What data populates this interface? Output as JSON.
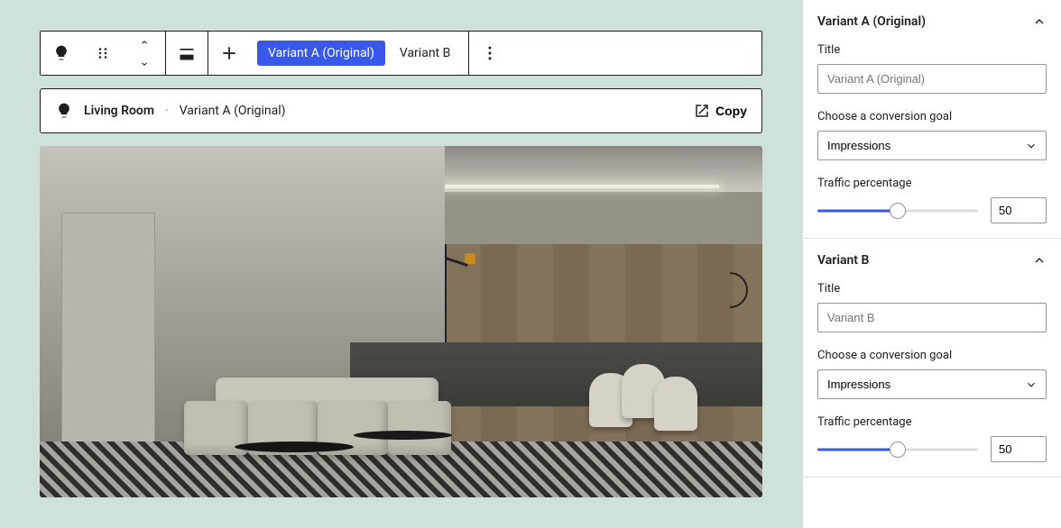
{
  "toolbar": {
    "variant_a_label": "Variant A (Original)",
    "variant_b_label": "Variant B"
  },
  "breadcrumb": {
    "name": "Living Room",
    "separator": "·",
    "variant": "Variant A (Original)",
    "copy_label": "Copy"
  },
  "sidebar": {
    "variant_a": {
      "header": "Variant A (Original)",
      "title_label": "Title",
      "title_placeholder": "Variant A (Original)",
      "goal_label": "Choose a conversion goal",
      "goal_value": "Impressions",
      "traffic_label": "Traffic percentage",
      "traffic_value": "50",
      "traffic_pct": 50
    },
    "variant_b": {
      "header": "Variant B",
      "title_label": "Title",
      "title_placeholder": "Variant B",
      "goal_label": "Choose a conversion goal",
      "goal_value": "Impressions",
      "traffic_label": "Traffic percentage",
      "traffic_value": "50",
      "traffic_pct": 50
    }
  }
}
